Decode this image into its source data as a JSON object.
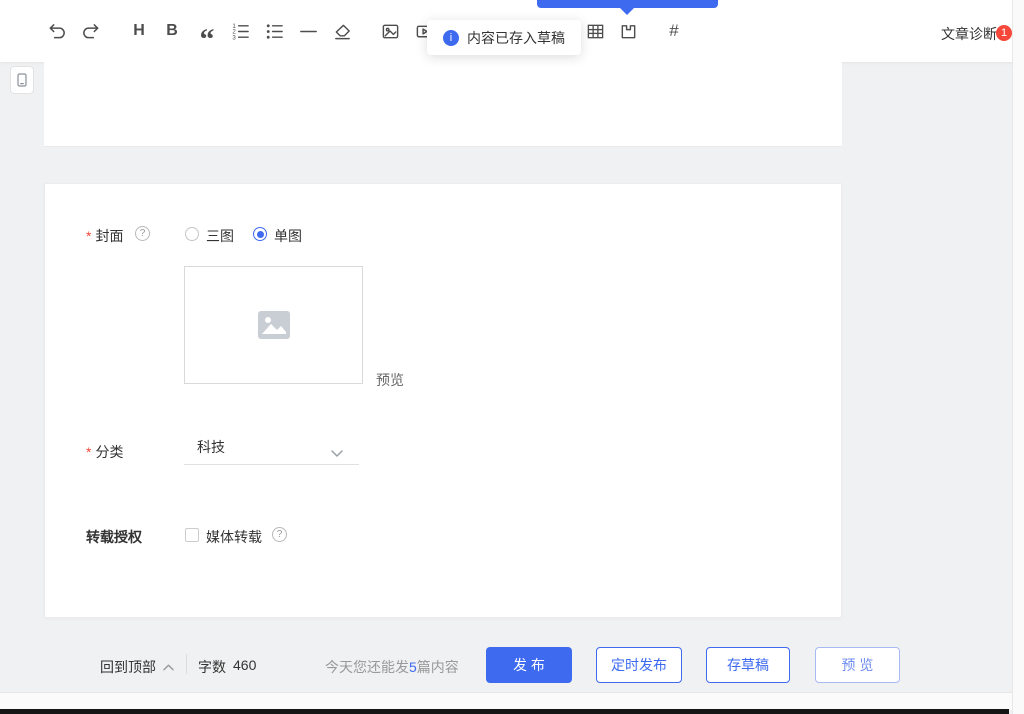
{
  "accent": "#3e6af0",
  "toolbar": {
    "heading_glyph": "H",
    "bold_glyph": "B",
    "quote_glyph": "“",
    "hashtag_glyph": "#",
    "diagnosis_label": "文章诊断",
    "diagnosis_badge": "1"
  },
  "toast": {
    "icon_glyph": "i",
    "message": "内容已存入草稿"
  },
  "form": {
    "cover": {
      "required_mark": "*",
      "label": "封面",
      "help_glyph": "?",
      "option_three": "三图",
      "option_single": "单图",
      "preview_label": "预览"
    },
    "category": {
      "required_mark": "*",
      "label": "分类",
      "value": "科技"
    },
    "reprint": {
      "label": "转载授权",
      "option": "媒体转载",
      "help_glyph": "?"
    }
  },
  "footer": {
    "back_to_top": "回到顶部",
    "word_count_label": "字数",
    "word_count_value": "460",
    "quota_prefix": "今天您还能发",
    "quota_count": "5",
    "quota_suffix": "篇内容",
    "publish_label": "发 布",
    "schedule_label": "定时发布",
    "draft_label": "存草稿",
    "preview_label": "预 览"
  }
}
